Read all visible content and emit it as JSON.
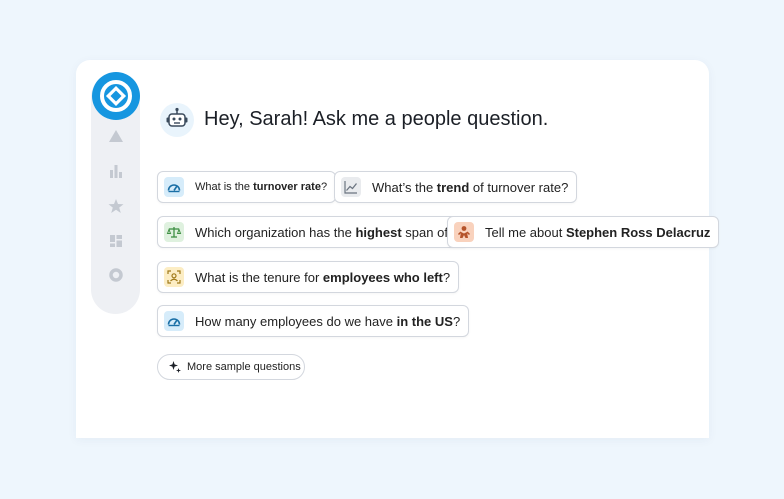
{
  "greeting": "Hey, Sarah! Ask me a people question.",
  "nav": {
    "logo": "target-logo-icon",
    "items": [
      "triangle-icon",
      "bar-chart-icon",
      "star-icon",
      "dashboard-icon",
      "circle-icon"
    ]
  },
  "questions": [
    {
      "icon": "gauge-icon",
      "parts": [
        "What is the ",
        "turnover rate",
        "?"
      ]
    },
    {
      "icon": "trend-icon",
      "parts": [
        "What’s the ",
        "trend",
        " of turnover rate?"
      ]
    },
    {
      "icon": "scale-icon",
      "parts": [
        "Which organization has the ",
        "highest",
        " span of..."
      ]
    },
    {
      "icon": "person-icon",
      "parts": [
        "Tell me about ",
        "Stephen Ross Delacruz",
        ""
      ]
    },
    {
      "icon": "face-scan-icon",
      "parts": [
        "What is the tenure for ",
        "employees who left",
        "?"
      ]
    },
    {
      "icon": "gauge-icon",
      "parts": [
        "How many employees do we have ",
        "in the US",
        "?"
      ]
    }
  ],
  "more_button": "More sample questions",
  "colors": {
    "brand": "#1696e0",
    "background": "#eef6fd",
    "gauge_bg": "#d6ecfa",
    "scale_bg": "#dff1df",
    "person_bg": "#f9d2bd",
    "face_bg": "#fcedc4",
    "trend_bg": "#e9ebee"
  }
}
